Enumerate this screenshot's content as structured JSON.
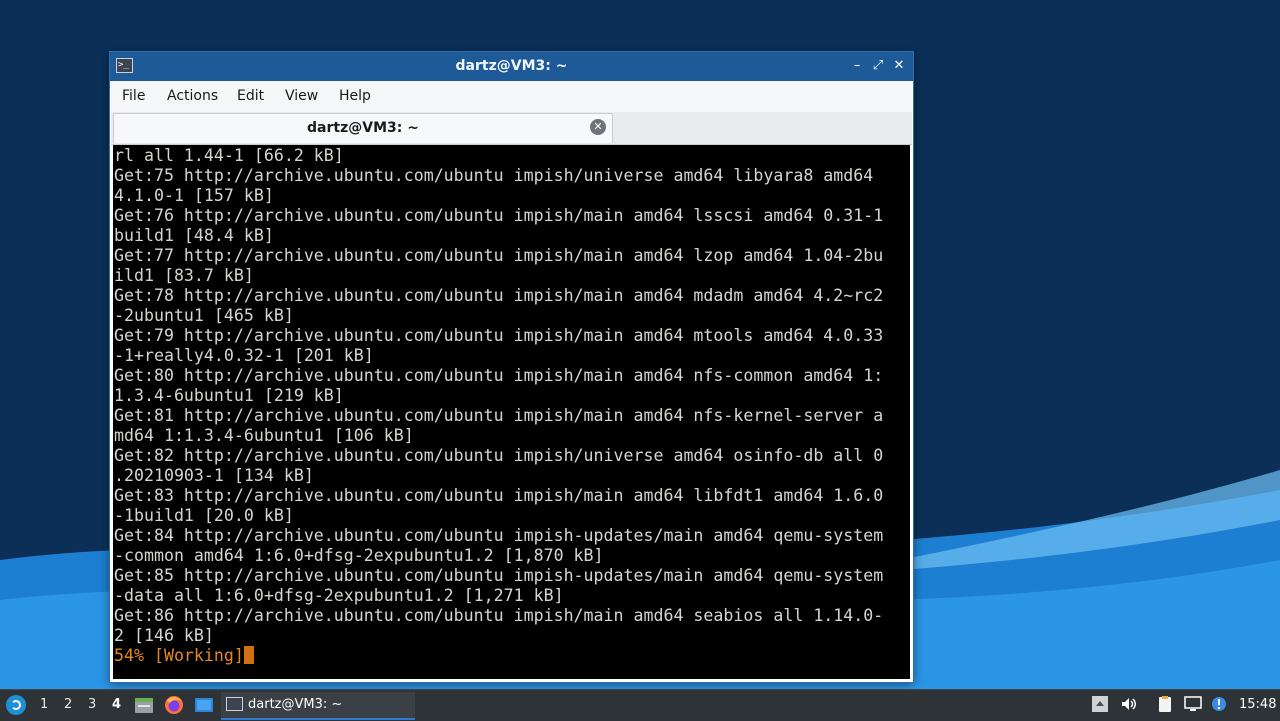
{
  "window": {
    "title": "dartz@VM3: ~"
  },
  "menu": {
    "file": "File",
    "actions": "Actions",
    "edit": "Edit",
    "view": "View",
    "help": "Help"
  },
  "tab": {
    "label": "dartz@VM3: ~"
  },
  "terminal": {
    "lines": [
      "rl all 1.44-1 [66.2 kB]",
      "Get:75 http://archive.ubuntu.com/ubuntu impish/universe amd64 libyara8 amd64",
      "4.1.0-1 [157 kB]",
      "Get:76 http://archive.ubuntu.com/ubuntu impish/main amd64 lsscsi amd64 0.31-1",
      "build1 [48.4 kB]",
      "Get:77 http://archive.ubuntu.com/ubuntu impish/main amd64 lzop amd64 1.04-2bu",
      "ild1 [83.7 kB]",
      "Get:78 http://archive.ubuntu.com/ubuntu impish/main amd64 mdadm amd64 4.2~rc2",
      "-2ubuntu1 [465 kB]",
      "Get:79 http://archive.ubuntu.com/ubuntu impish/main amd64 mtools amd64 4.0.33",
      "-1+really4.0.32-1 [201 kB]",
      "Get:80 http://archive.ubuntu.com/ubuntu impish/main amd64 nfs-common amd64 1:",
      "1.3.4-6ubuntu1 [219 kB]",
      "Get:81 http://archive.ubuntu.com/ubuntu impish/main amd64 nfs-kernel-server a",
      "md64 1:1.3.4-6ubuntu1 [106 kB]",
      "Get:82 http://archive.ubuntu.com/ubuntu impish/universe amd64 osinfo-db all 0",
      ".20210903-1 [134 kB]",
      "Get:83 http://archive.ubuntu.com/ubuntu impish/main amd64 libfdt1 amd64 1.6.0",
      "-1build1 [20.0 kB]",
      "Get:84 http://archive.ubuntu.com/ubuntu impish-updates/main amd64 qemu-system",
      "-common amd64 1:6.0+dfsg-2expubuntu1.2 [1,870 kB]",
      "Get:85 http://archive.ubuntu.com/ubuntu impish-updates/main amd64 qemu-system",
      "-data all 1:6.0+dfsg-2expubuntu1.2 [1,271 kB]",
      "Get:86 http://archive.ubuntu.com/ubuntu impish/main amd64 seabios all 1.14.0-",
      "2 [146 kB]"
    ],
    "progress_line": "54% [Working]"
  },
  "taskbar": {
    "workspaces": [
      "1",
      "2",
      "3",
      "4"
    ],
    "active_workspace": "4",
    "task_label": "dartz@VM3: ~",
    "clock": "15:48"
  },
  "colors": {
    "titlebar": "#1e5a98",
    "terminal_bg": "#000000",
    "terminal_fg": "#d3d7cf",
    "progress": "#e3891f",
    "taskbar": "#2e3338"
  },
  "icons": {
    "start": "lubuntu-logo-icon",
    "file_manager": "file-manager-icon",
    "browser": "firefox-icon",
    "desktop": "show-desktop-icon",
    "terminal": "terminal-icon",
    "tray": [
      "tray-expand-icon",
      "volume-icon",
      "clipboard-icon",
      "network-icon",
      "notification-icon"
    ]
  }
}
